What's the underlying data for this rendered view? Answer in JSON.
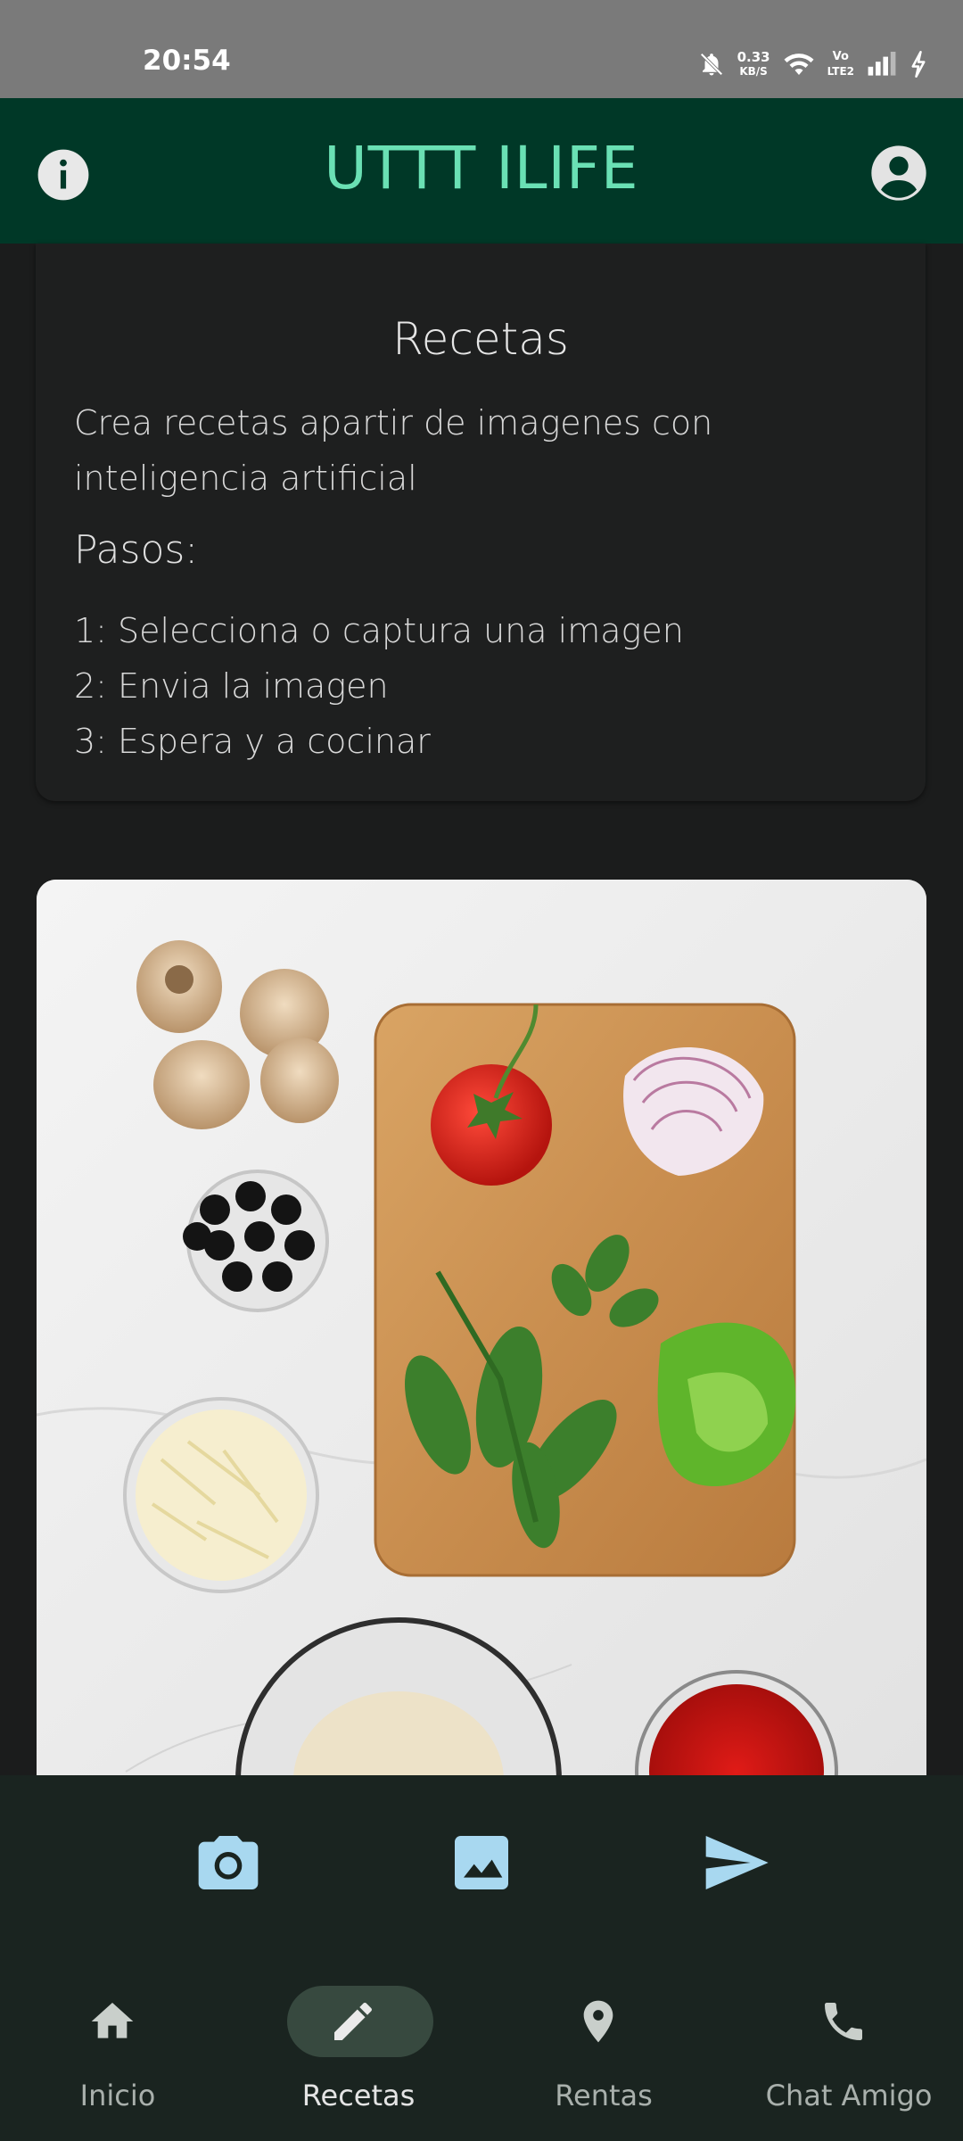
{
  "status_bar": {
    "time": "20:54",
    "net_speed_value": "0.33",
    "net_speed_unit": "KB/S",
    "volte_top": "Vo",
    "volte_bottom": "LTE2",
    "icons": [
      "bell-off-icon",
      "wifi-icon",
      "volte-icon",
      "signal-icon",
      "charging-icon"
    ]
  },
  "app_bar": {
    "title": "UTTT ILIFE",
    "left_icon": "info-icon",
    "right_icon": "account-circle-icon",
    "background": "#003827",
    "title_color": "#6ae0b4"
  },
  "intro_card": {
    "title": "Recetas",
    "description": "Crea recetas apartir de imagenes con inteligencia artificial",
    "steps_heading": "Pasos:",
    "steps": [
      "1: Selecciona o captura una imagen",
      "2: Envia la imagen",
      "3: Espera y a cocinar"
    ]
  },
  "image_preview": {
    "subject": "pizza ingredients on a cutting board"
  },
  "actions": [
    {
      "icon": "camera-icon"
    },
    {
      "icon": "image-icon"
    },
    {
      "icon": "send-icon"
    }
  ],
  "bottom_nav": {
    "selected": "Recetas",
    "items": [
      {
        "label": "Inicio",
        "icon": "home-icon"
      },
      {
        "label": "Recetas",
        "icon": "pencil-icon"
      },
      {
        "label": "Rentas",
        "icon": "location-pin-icon"
      },
      {
        "label": "Chat Amigo",
        "icon": "phone-icon"
      }
    ]
  },
  "colors": {
    "background": "#1b1c1c",
    "action_icon": "#a8d8f0",
    "nav_active_pill": "#37493f"
  }
}
